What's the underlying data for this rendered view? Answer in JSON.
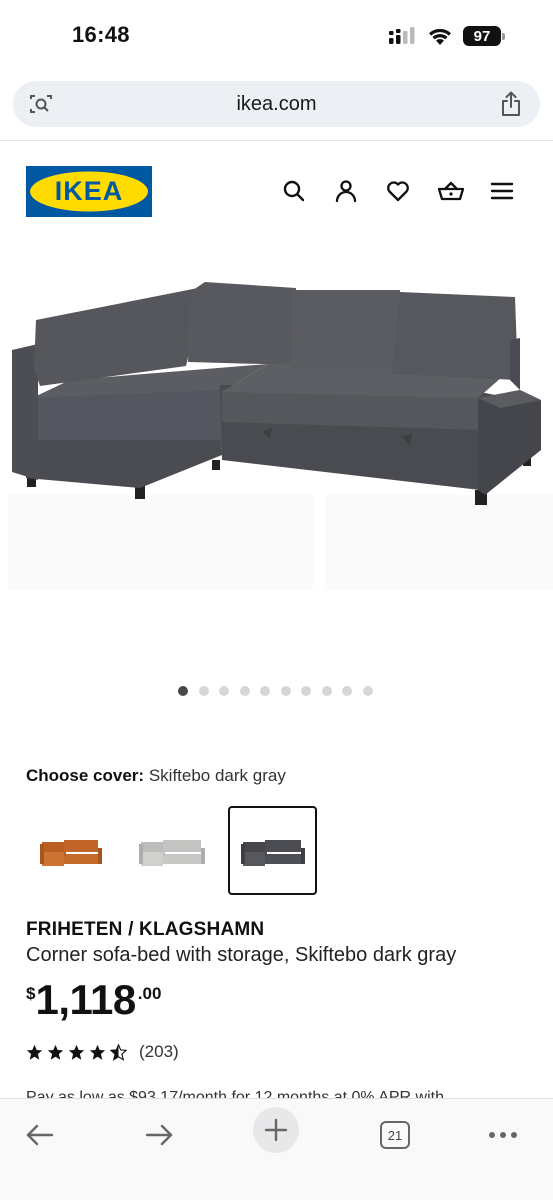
{
  "status_bar": {
    "time": "16:48",
    "battery": "97",
    "icons": [
      "signal-icon",
      "wifi-icon",
      "battery-icon"
    ]
  },
  "browser": {
    "url": "ikea.com",
    "left_icon": "visual-search-icon",
    "share_icon": "share-icon"
  },
  "header": {
    "logo_text": "IKEA",
    "icons": [
      "search-icon",
      "account-icon",
      "heart-icon",
      "cart-icon",
      "menu-icon"
    ],
    "colors": {
      "logo_blue": "#0058a3",
      "logo_yellow": "#ffdb00"
    }
  },
  "gallery": {
    "image_alt": "FRIHETEN corner sofa-bed in Skiftebo dark gray",
    "dot_count": 10,
    "active_dot": 0
  },
  "cover": {
    "label": "Choose cover:",
    "value": "Skiftebo dark gray",
    "swatches": [
      {
        "name": "orange-brown",
        "color": "#c46a2a",
        "selected": false
      },
      {
        "name": "light gray",
        "color": "#c8c8c6",
        "selected": false
      },
      {
        "name": "dark gray",
        "color": "#4e5055",
        "selected": true
      }
    ]
  },
  "product": {
    "name": "FRIHETEN / KLAGSHAMN",
    "description": "Corner sofa-bed with storage, Skiftebo dark gray",
    "price_currency": "$",
    "price_whole": "1,118",
    "price_cents": ".00",
    "rating": 4.5,
    "review_count": "(203)",
    "financing_text": "Pay as low as $93.17/month for 12 months at 0% APR with"
  },
  "toolbar": {
    "tab_count": "21",
    "icons": [
      "back-arrow-icon",
      "forward-arrow-icon",
      "plus-icon",
      "tabs-icon",
      "more-icon"
    ]
  }
}
